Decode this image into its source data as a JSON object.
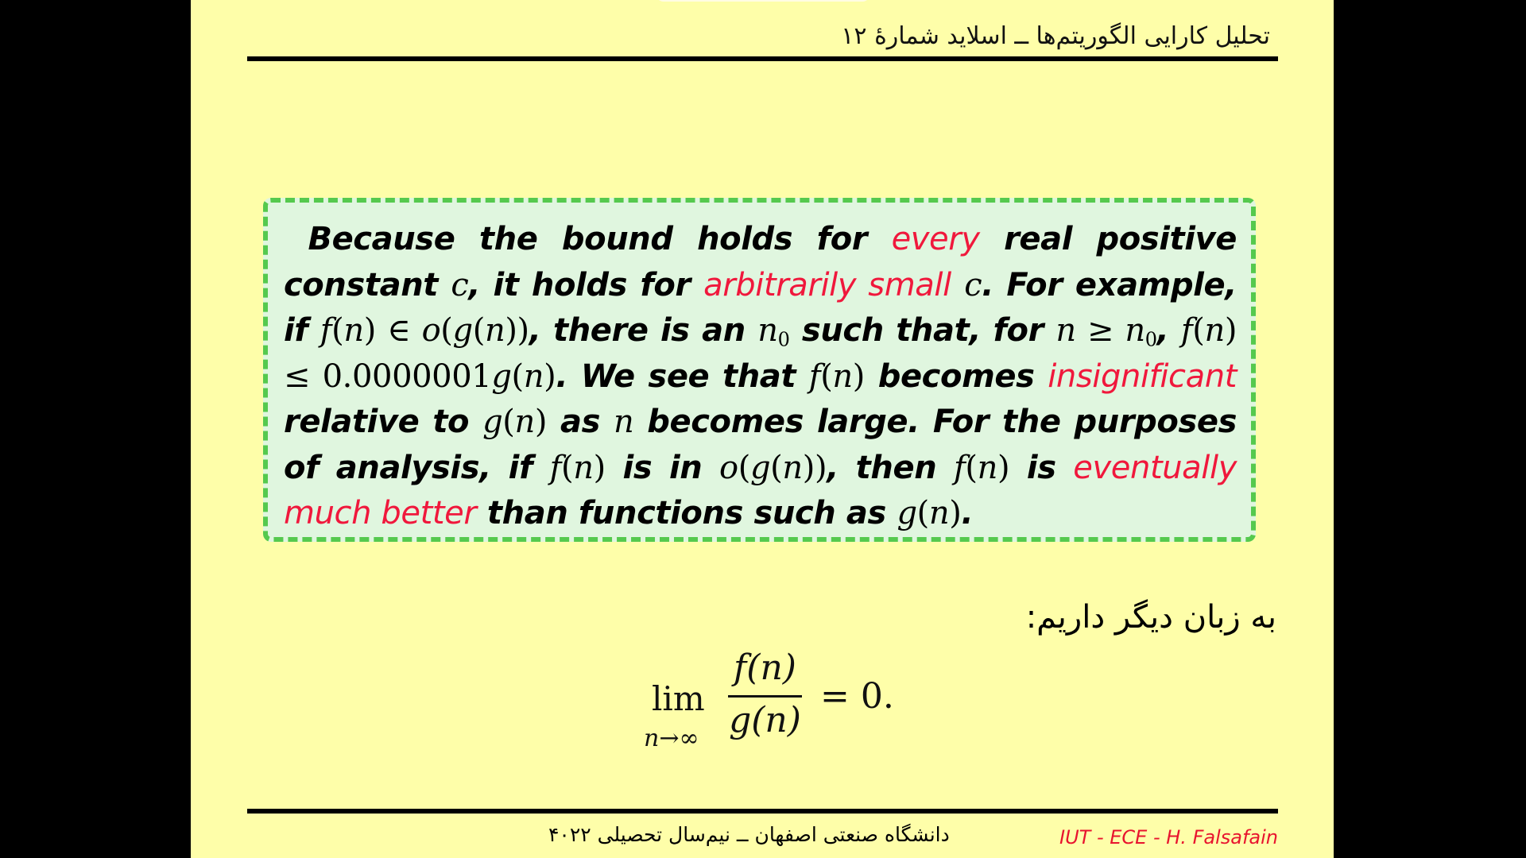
{
  "header": {
    "title": "تحلیل کارایی الگوریتم‌ها ــ اسلاید شمارهٔ ۱۲"
  },
  "box": {
    "t1": "Because the bound holds for ",
    "h1": "every",
    "t2": " real positive constant ",
    "t3": ", it holds for ",
    "h2": "arbitrarily small",
    "t4": ".  For example, if ",
    "t5": ", there is an ",
    "t6": " such that, for ",
    "t7": ". We see that ",
    "t8": " becomes ",
    "h3": "insignificant",
    "t9": " relative to ",
    "t10": " as ",
    "t11": " becomes large.  For the purposes of analysis, if ",
    "t12": " is in ",
    "t13": ", then ",
    "t14": " is ",
    "h4": "eventually much better",
    "t15": " than functions such as ",
    "t16": "."
  },
  "colors": {
    "slide_background": "#fefea9",
    "box_background": "#e0f6df",
    "box_border": "#55c94e",
    "highlight": "#f0183c"
  },
  "persian_line": "به زبان دیگر داریم:",
  "formula": {
    "lim": "lim",
    "lim_sub": "n→∞",
    "numerator": "f(n)",
    "denominator": "g(n)",
    "rhs": "= 0."
  },
  "footer": {
    "center": "دانشگاه صنعتی اصفهان ــ نیم‌سال تحصیلی ۴۰۲۲",
    "right": "IUT - ECE - H. Falsafain"
  }
}
